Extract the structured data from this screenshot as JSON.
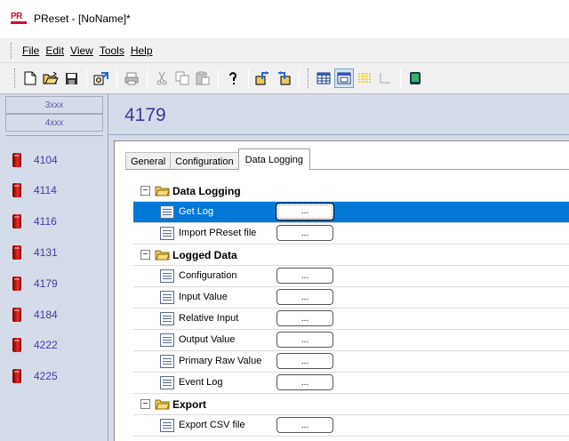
{
  "window": {
    "title": "PReset - [NoName]*",
    "logo_text": "PR"
  },
  "menu": [
    {
      "label": "File"
    },
    {
      "label": "Edit"
    },
    {
      "label": "View"
    },
    {
      "label": "Tools"
    },
    {
      "label": "Help"
    }
  ],
  "toolbar": {
    "buttons": [
      "new-icon",
      "open-icon",
      "save-icon",
      "import-icon",
      "print-icon",
      "cut-icon",
      "copy-icon",
      "paste-icon",
      "help-icon",
      "upload-icon",
      "download-icon",
      "table-view-icon",
      "form-view-icon",
      "chart-icon",
      "axes-icon",
      "monitor-icon"
    ]
  },
  "left": {
    "range_tabs": [
      "3xxx",
      "4xxx"
    ],
    "modules": [
      "4104",
      "4114",
      "4116",
      "4131",
      "4179",
      "4184",
      "4222",
      "4225"
    ]
  },
  "header": {
    "module_id": "4179"
  },
  "tabs": [
    {
      "label": "General"
    },
    {
      "label": "Configuration"
    },
    {
      "label": "Data Logging",
      "active": true
    }
  ],
  "grid": {
    "button_label": "...",
    "expander_symbol": "−",
    "groups": [
      {
        "label": "Data Logging",
        "items": [
          "Get Log",
          "Import PReset file"
        ]
      },
      {
        "label": "Logged Data",
        "items": [
          "Configuration",
          "Input Value",
          "Relative Input",
          "Output Value",
          "Primary Raw Value",
          "Event Log"
        ]
      },
      {
        "label": "Export",
        "items": [
          "Export CSV file"
        ]
      }
    ],
    "selected_item": "Get Log"
  },
  "colors": {
    "panel_bg": "#d4dbe9",
    "link_text": "#4040a8",
    "header_text": "#3c3c9c",
    "selection": "#0078d7",
    "brand_red": "#c8102e"
  }
}
